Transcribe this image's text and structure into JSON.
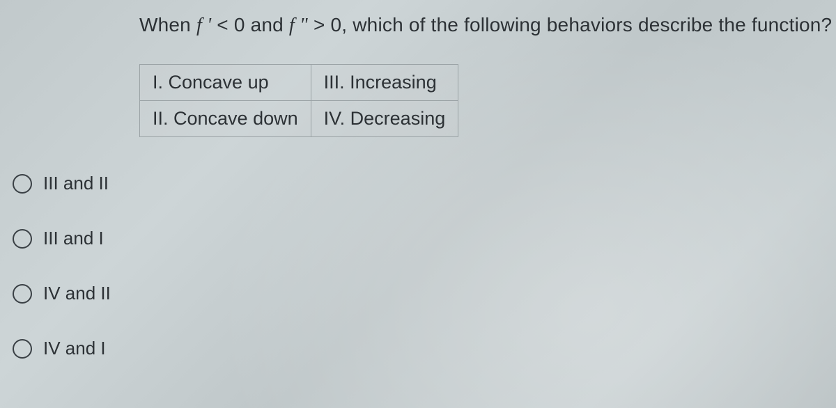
{
  "question": {
    "prefix": "When ",
    "f1": "f '",
    "cmp1": " < 0 and ",
    "f2": "f \"",
    "cmp2": " > 0, which of the following behaviors describe the function?"
  },
  "table": {
    "r1c1": "I. Concave up",
    "r1c2": "III. Increasing",
    "r2c1": "II. Concave down",
    "r2c2": "IV. Decreasing"
  },
  "options": [
    {
      "label": "III and II"
    },
    {
      "label": "III and I"
    },
    {
      "label": "IV and II"
    },
    {
      "label": "IV and I"
    }
  ]
}
